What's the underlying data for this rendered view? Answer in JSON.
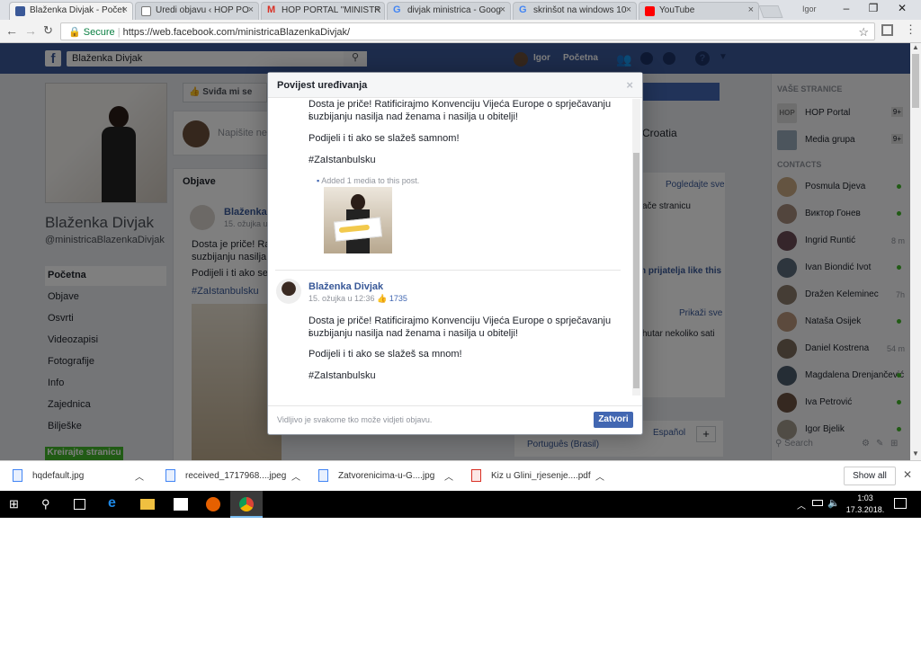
{
  "browser": {
    "tabs": [
      {
        "title": "Blaženka Divjak - Počet",
        "icon_color": "#3b5998",
        "active": true
      },
      {
        "title": "Uredi objavu ‹ HOP PO",
        "icon_color": "#777777",
        "active": false
      },
      {
        "title": "HOP PORTAL \"MINISTR",
        "icon_color": "#d93025",
        "active": false
      },
      {
        "title": "divjak ministrica - Goog",
        "icon_color": "#4285f4",
        "active": false
      },
      {
        "title": "skrinšot na windows 10",
        "icon_color": "#4285f4",
        "active": false
      },
      {
        "title": "YouTube",
        "icon_color": "#ff0000",
        "active": false
      }
    ],
    "profile_name": "Igor",
    "secure_label": "Secure",
    "url": "https://web.facebook.com/ministricaBlazenkaDivjak/"
  },
  "fb": {
    "search_value": "Blaženka Divjak",
    "user_name": "Igor",
    "home_label": "Početna",
    "profile": {
      "name": "Blaženka Divjak",
      "handle": "@ministricaBlazenkaDivjak"
    },
    "nav": [
      "Početna",
      "Objave",
      "Osvrti",
      "Videozapisi",
      "Fotografije",
      "Info",
      "Zajednica",
      "Bilješke"
    ],
    "create_page_button": "Kreirajte stranicu",
    "like_button": "Sviđa mi se",
    "composer_placeholder": "Napišite neš",
    "posts_header": "Objave",
    "bg_post": {
      "author": "Blaženka",
      "date": "15. ožujka u",
      "text1": "Dosta je priče! Rat",
      "text2": "suzbijanju nasilja n",
      "text3": "Podijeli i ti ako se s",
      "hashtag": "#ZaIstanbulsku"
    },
    "right_col": {
      "croatia": "Croatia",
      "see_all": "Pogledajte sve",
      "like_page_text": "ače stranicu",
      "friends_like": "h prijatelja like this",
      "show_all": "Prikaži sve",
      "hours_text": "hutar nekoliko sati",
      "lang1": "Español",
      "lang2": "Português (Brasil)"
    },
    "sidebar": {
      "your_pages_header": "VAŠE STRANICE",
      "pages": [
        {
          "name": "HOP Portal",
          "badge": "9+"
        },
        {
          "name": "Media grupa",
          "badge": "9+"
        }
      ],
      "contacts_header": "CONTACTS",
      "contacts": [
        {
          "name": "Posmula Djeva",
          "status": "online",
          "time": ""
        },
        {
          "name": "Виктор Гонев",
          "status": "online",
          "time": ""
        },
        {
          "name": "Ingrid Runtić",
          "status": "away",
          "time": "8 m"
        },
        {
          "name": "Ivan Biondić Ivot",
          "status": "online",
          "time": ""
        },
        {
          "name": "Dražen Keleminec",
          "status": "away",
          "time": "7h"
        },
        {
          "name": "Nataša Osijek",
          "status": "online",
          "time": ""
        },
        {
          "name": "Daniel Kostrena",
          "status": "away",
          "time": "54 m"
        },
        {
          "name": "Magdalena Drenjančević",
          "status": "online",
          "time": ""
        },
        {
          "name": "Iva Petrović",
          "status": "online",
          "time": ""
        },
        {
          "name": "Igor Bjelik",
          "status": "online",
          "time": ""
        }
      ],
      "search_placeholder": "Search"
    }
  },
  "modal": {
    "title": "Povijest uređivanja",
    "close_glyph": "×",
    "version1": {
      "line1": "Dosta je priče! Ratificirajmo Konvenciju Vijeća Europe o sprječavanju i",
      "line2": "suzbijanju nasilja nad ženama i nasilja u obitelji!",
      "line3": "Podijeli i ti ako se slažeš samnom!",
      "hashtag": "#ZaIstanbulsku",
      "media_note": "Added 1 media to this post."
    },
    "version2": {
      "author": "Blaženka Divjak",
      "date": "15. ožujka u 12:36",
      "likes": "1735",
      "line1": "Dosta je priče! Ratificirajmo Konvenciju Vijeća Europe o sprječavanju i",
      "line2": "suzbijanju nasilja nad ženama i nasilja u obitelji!",
      "line3": "Podijeli i ti ako se slažeš sa mnom!",
      "hashtag": "#ZaIstanbulsku"
    },
    "footer_note": "Vidljivo je svakome tko može vidjeti objavu.",
    "close_button": "Zatvori"
  },
  "downloads": {
    "items": [
      "hqdefault.jpg",
      "received_1717968....jpeg",
      "Zatvorenicima-u-G....jpg",
      "Kiz u Glini_rjesenje....pdf"
    ],
    "show_all": "Show all"
  },
  "taskbar": {
    "time": "1:03",
    "date": "17.3.2018."
  }
}
